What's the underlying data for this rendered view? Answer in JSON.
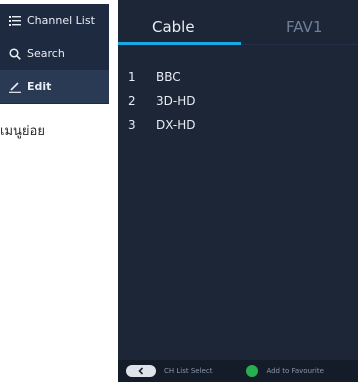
{
  "submenu": {
    "items": [
      {
        "label": "Channel List",
        "icon": "list-icon",
        "active": false
      },
      {
        "label": "Search",
        "icon": "search-icon",
        "active": false
      },
      {
        "label": "Edit",
        "icon": "edit-icon",
        "active": true
      }
    ],
    "caption": "เมนูย่อย"
  },
  "panel": {
    "tabs": [
      {
        "label": "Cable",
        "selected": true
      },
      {
        "label": "FAV1",
        "selected": false
      }
    ],
    "channels": [
      {
        "number": "1",
        "name": "BBC"
      },
      {
        "number": "2",
        "name": "3D-HD"
      },
      {
        "number": "3",
        "name": "DX-HD"
      }
    ],
    "footer": {
      "left_hint": "CH List Select",
      "right_hint": "Add to Favourite"
    }
  },
  "colors": {
    "menu_bg": "#1e2a3f",
    "panel_bg": "#1c2637",
    "accent": "#1aa7e6",
    "green_key": "#27ae4f"
  }
}
